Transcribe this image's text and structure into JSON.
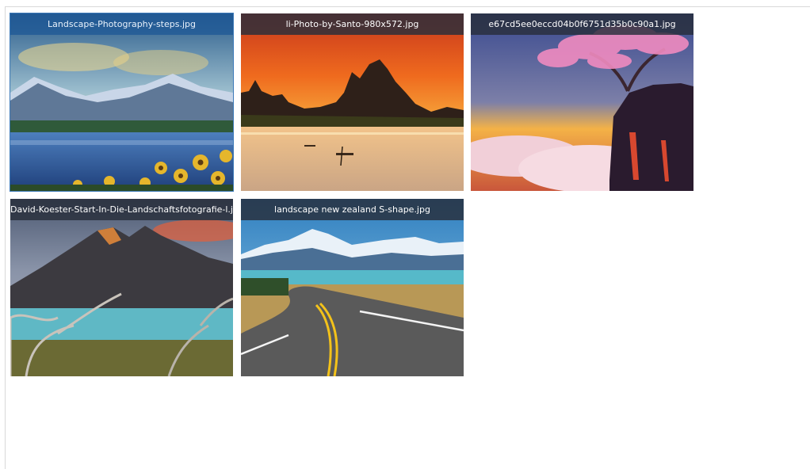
{
  "gallery": {
    "items": [
      {
        "filename": "Landscape-Photography-steps.jpg",
        "selected": true
      },
      {
        "filename": "li-Photo-by-Santo-980x572.jpg",
        "selected": false
      },
      {
        "filename": "e67cd5ee0eccd04b0f6751d35b0c90a1.jpg",
        "selected": false
      },
      {
        "filename": "David-Koester-Start-In-Die-Landschaftsfotografie-l.jpg",
        "selected": false
      },
      {
        "filename": "landscape new zealand S-shape.jpg",
        "selected": false
      }
    ]
  },
  "colors": {
    "selected_caption": "#1f5896",
    "caption_bg": "#282e3a"
  }
}
